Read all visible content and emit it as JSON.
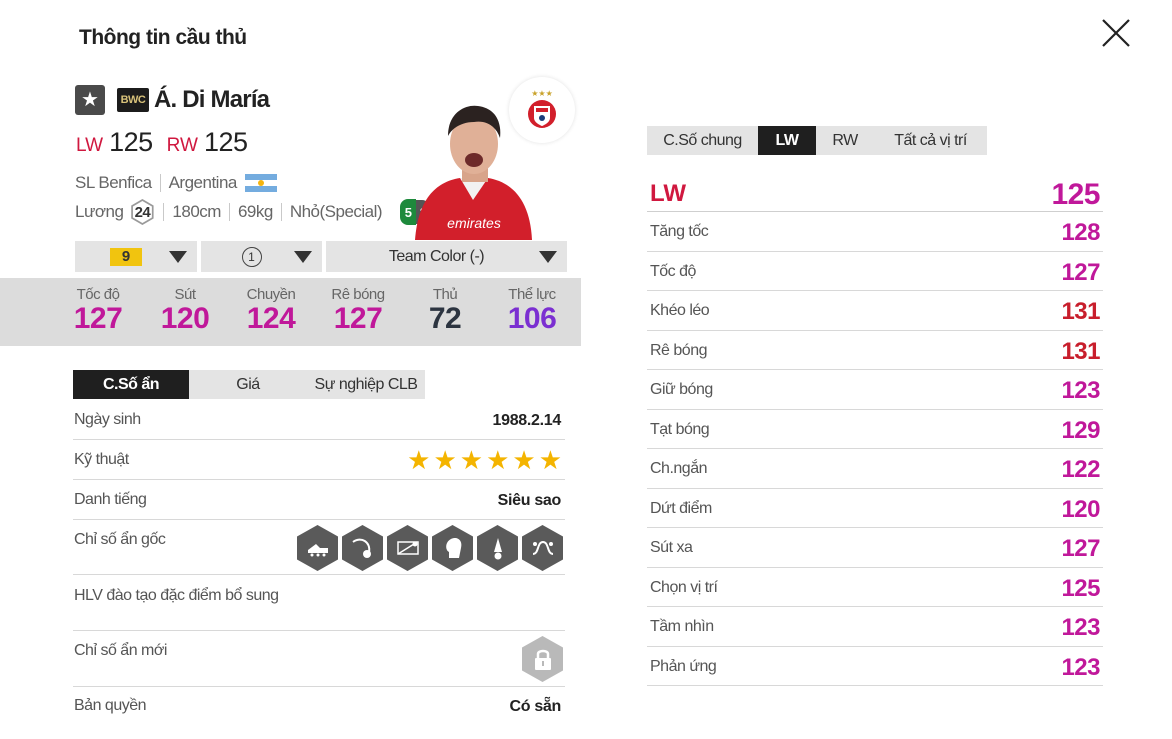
{
  "header": {
    "title": "Thông tin cầu thủ"
  },
  "player": {
    "season_badge": "BWC",
    "name": "Á. Di María",
    "positions": [
      {
        "pos": "LW",
        "ovr": "125"
      },
      {
        "pos": "RW",
        "ovr": "125"
      }
    ],
    "club": "SL Benfica",
    "nation": "Argentina",
    "salary_label": "Lương",
    "salary": "24",
    "height": "180cm",
    "weight": "69kg",
    "body_type": "Nhỏ(Special)",
    "weak_foot_left": "5",
    "weak_foot_right": "2"
  },
  "controls": {
    "grade": "9",
    "level": "1",
    "team_color": "Team Color (-)"
  },
  "main_stats": [
    {
      "label": "Tốc độ",
      "value": "127",
      "color": "#c0189a"
    },
    {
      "label": "Sút",
      "value": "120",
      "color": "#c0189a"
    },
    {
      "label": "Chuyền",
      "value": "124",
      "color": "#c0189a"
    },
    {
      "label": "Rê bóng",
      "value": "127",
      "color": "#c0189a"
    },
    {
      "label": "Thủ",
      "value": "72",
      "color": "#2c3440"
    },
    {
      "label": "Thể lực",
      "value": "106",
      "color": "#7b2fd1"
    }
  ],
  "left_tabs": [
    "C.Số ẩn",
    "Giá",
    "Sự nghiệp CLB"
  ],
  "info": {
    "birth_label": "Ngày sinh",
    "birth": "1988.2.14",
    "skill_label": "Kỹ thuật",
    "skill_stars": 6,
    "rep_label": "Danh tiếng",
    "rep": "Siêu sao",
    "traits_label": "Chỉ số ẩn gốc",
    "coach_label": "HLV đào tạo đặc điểm bổ sung",
    "new_traits_label": "Chỉ số ẩn mới",
    "license_label": "Bản quyền",
    "license": "Có sẵn"
  },
  "trait_icons": [
    "boot-icon",
    "ball-curve-icon",
    "goal-net-icon",
    "head-icon",
    "shirt-ball-icon",
    "dribble-path-icon"
  ],
  "right_tabs": [
    "C.Số chung",
    "LW",
    "RW",
    "Tất cả vị trí"
  ],
  "right_header": {
    "pos": "LW",
    "value": "125"
  },
  "attributes": [
    {
      "label": "Tăng tốc",
      "value": "128",
      "color": "#c0189a"
    },
    {
      "label": "Tốc độ",
      "value": "127",
      "color": "#c0189a"
    },
    {
      "label": "Khéo léo",
      "value": "131",
      "color": "#c81e2c"
    },
    {
      "label": "Rê bóng",
      "value": "131",
      "color": "#c81e2c"
    },
    {
      "label": "Giữ bóng",
      "value": "123",
      "color": "#c0189a"
    },
    {
      "label": "Tạt bóng",
      "value": "129",
      "color": "#c0189a"
    },
    {
      "label": "Ch.ngắn",
      "value": "122",
      "color": "#c0189a"
    },
    {
      "label": "Dứt điểm",
      "value": "120",
      "color": "#c0189a"
    },
    {
      "label": "Sút xa",
      "value": "127",
      "color": "#c0189a"
    },
    {
      "label": "Chọn vị trí",
      "value": "125",
      "color": "#c0189a"
    },
    {
      "label": "Tầm nhìn",
      "value": "123",
      "color": "#c0189a"
    },
    {
      "label": "Phản ứng",
      "value": "123",
      "color": "#c0189a"
    }
  ]
}
